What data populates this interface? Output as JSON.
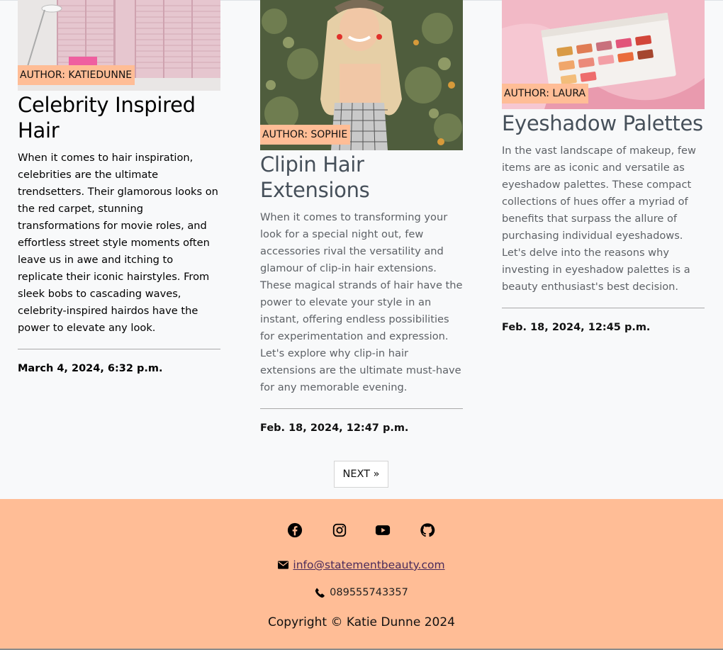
{
  "posts": [
    {
      "author": "AUTHOR: KATIEDUNNE",
      "title": "Celebrity Inspired Hair",
      "excerpt": "When it comes to hair inspiration, celebrities are the ultimate trendsetters. Their glamorous looks on the red carpet, stunning transformations for movie roles, and effortless street style moments often leave us in awe and itching to replicate their iconic hairstyles. From sleek bobs to cascading waves, celebrity-inspired hairdos have the power to elevate any look.",
      "date": "March 4, 2024, 6:32 p.m."
    },
    {
      "author": "AUTHOR: SOPHIE",
      "title": "Clipin Hair Extensions",
      "excerpt": "When it comes to transforming your look for a special night out, few accessories rival the versatility and glamour of clip-in hair extensions. These magical strands of hair have the power to elevate your style in an instant, offering endless possibilities for experimentation and expression. Let's explore why clip-in hair extensions are the ultimate must-have for any memorable evening.",
      "date": "Feb. 18, 2024, 12:47 p.m."
    },
    {
      "author": "AUTHOR: LAURA",
      "title": "Eyeshadow Palettes",
      "excerpt": "In the vast landscape of makeup, few items are as iconic and versatile as eyeshadow palettes. These compact collections of hues offer a myriad of benefits that surpass the allure of purchasing individual eyeshadows. Let's delve into the reasons why investing in eyeshadow palettes is a beauty enthusiast's best decision.",
      "date": "Feb. 18, 2024, 12:45 p.m."
    }
  ],
  "pagination": {
    "next_label": "NEXT »"
  },
  "footer": {
    "social_icons": [
      "facebook-icon",
      "instagram-icon",
      "youtube-icon",
      "github-icon"
    ],
    "email": "info@statementbeauty.com",
    "phone": "089555743357",
    "copyright": "Copyright © Katie Dunne 2024",
    "background": "#ffbd96",
    "email_link_color": "#4b2b5a"
  },
  "colors": {
    "page_bg": "#f8f9fa",
    "author_badge": "#ffbd96"
  }
}
